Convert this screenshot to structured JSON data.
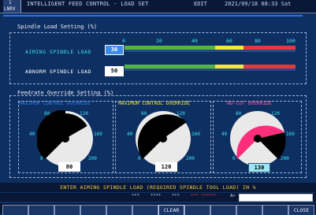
{
  "header": {
    "machine_id_top": "1",
    "machine_id_bottom": "LNRV",
    "title": "INTELLIGENT FEED CONTROL - LOAD SET",
    "mode": "EDIT",
    "datetime": "2021/09/18 08:33 Sat"
  },
  "spindle_panel": {
    "title": "Spindle Load Setting (%)",
    "scale": [
      "0",
      "20",
      "40",
      "60",
      "80",
      "100"
    ],
    "aiming": {
      "label": "AIMING SPINDLE LOAD",
      "value": "30"
    },
    "abnorm": {
      "label": "ABNORM SPINDLE LOAD",
      "value": "50"
    }
  },
  "feedrate_panel": {
    "title": "Feedrate Override Setting (%)",
    "gauges": [
      {
        "title": "MAXIMUM CONTROL OVERRIDE",
        "value": "80",
        "level": 80
      },
      {
        "title": "MAXIMUM CONTROL OVERRIDE",
        "value": "120",
        "level": 120
      },
      {
        "title": "NO-CUT OVERRIDE",
        "value": "130",
        "level": 130
      }
    ],
    "scale": [
      "0",
      "40",
      "80",
      "120",
      "160",
      "200"
    ]
  },
  "prompt": "ENTER AIMING SPINDLE LOAD (REQUIRED SPINDLE TOOL LOAD) IN %",
  "input_row": {
    "segments": [
      "***",
      "****",
      "***",
      "*** ******"
    ],
    "prompt_char": "A>",
    "value": ""
  },
  "softkeys": [
    "",
    "",
    "",
    "",
    "",
    "",
    "CLEAR",
    "",
    "",
    "",
    "",
    "CLOSE"
  ],
  "colors": {
    "background": "#0e2f62",
    "accent_cyan": "#3de3f0",
    "prompt_yellow": "#f2cc33",
    "nocut_pink": "#ff2e7c",
    "aiming_box": "#3f8ce8"
  }
}
